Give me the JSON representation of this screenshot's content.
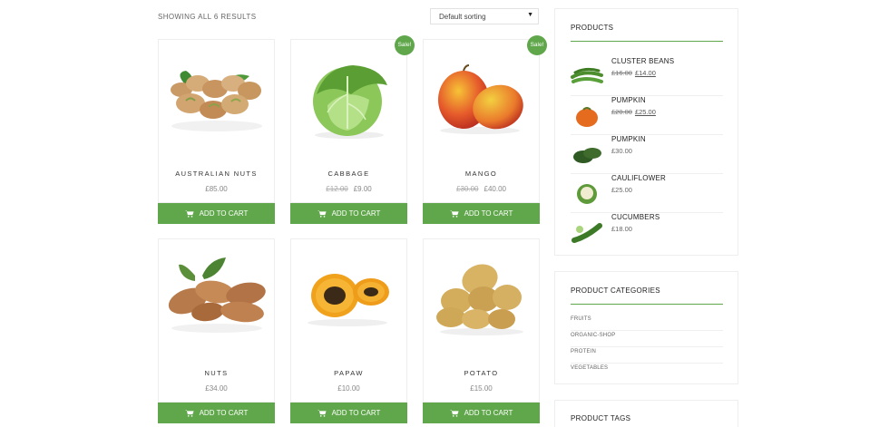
{
  "shop": {
    "result_count": "SHOWING ALL 6 RESULTS",
    "sort_selected": "Default sorting"
  },
  "products": [
    {
      "name": "AUSTRALIAN NUTS",
      "old_price": "",
      "price": "£85.00",
      "sale": false,
      "sale_label": "",
      "cart_label": "ADD TO CART"
    },
    {
      "name": "CABBAGE",
      "old_price": "£12.00",
      "price": "£9.00",
      "sale": true,
      "sale_label": "Sale!",
      "cart_label": "ADD TO CART"
    },
    {
      "name": "MANGO",
      "old_price": "£30.00",
      "price": "£40.00",
      "sale": true,
      "sale_label": "Sale!",
      "cart_label": "ADD TO CART"
    },
    {
      "name": "NUTS",
      "old_price": "",
      "price": "£34.00",
      "sale": false,
      "sale_label": "",
      "cart_label": "ADD TO CART"
    },
    {
      "name": "PAPAW",
      "old_price": "",
      "price": "£10.00",
      "sale": false,
      "sale_label": "",
      "cart_label": "ADD TO CART"
    },
    {
      "name": "POTATO",
      "old_price": "",
      "price": "£15.00",
      "sale": false,
      "sale_label": "",
      "cart_label": "ADD TO CART"
    }
  ],
  "sidebar": {
    "products_widget": {
      "title": "PRODUCTS",
      "items": [
        {
          "name": "CLUSTER BEANS",
          "old_price": "£16.00",
          "price": "£14.00"
        },
        {
          "name": "PUMPKIN",
          "old_price": "£20.00",
          "price": "£25.00"
        },
        {
          "name": "PUMPKIN",
          "old_price": "",
          "price": "£30.00"
        },
        {
          "name": "CAULIFLOWER",
          "old_price": "",
          "price": "£25.00"
        },
        {
          "name": "CUCUMBERS",
          "old_price": "",
          "price": "£18.00"
        }
      ]
    },
    "categories_widget": {
      "title": "PRODUCT CATEGORIES",
      "items": [
        "FRUITS",
        "ORGANIC-SHOP",
        "PROTEIN",
        "VEGETABLES"
      ]
    },
    "tags_widget": {
      "title": "PRODUCT TAGS"
    }
  },
  "colors": {
    "accent": "#5fa74a",
    "border": "#eeeeee"
  },
  "icons": [
    "cart-icon",
    "chevron-down-icon"
  ]
}
